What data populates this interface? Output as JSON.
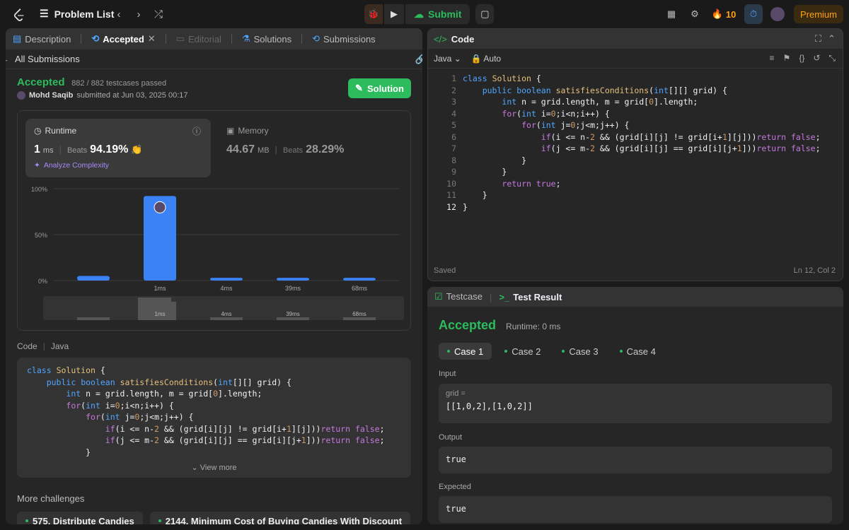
{
  "topbar": {
    "problem_list": "Problem List",
    "submit": "Submit",
    "streak": "10",
    "premium": "Premium"
  },
  "left": {
    "tabs": [
      {
        "label": "Description"
      },
      {
        "label": "Accepted"
      },
      {
        "label": "Editorial"
      },
      {
        "label": "Solutions"
      },
      {
        "label": "Submissions"
      }
    ],
    "all_submissions": "All Submissions",
    "status": "Accepted",
    "testcases": "882 / 882 testcases passed",
    "user": "Mohd Saqib",
    "submitted": "submitted at Jun 03, 2025 00:17",
    "solution_btn": "Solution",
    "runtime": {
      "title": "Runtime",
      "value": "1",
      "unit": "ms",
      "beats_label": "Beats",
      "beats": "94.19%",
      "analyze": "Analyze Complexity"
    },
    "memory": {
      "title": "Memory",
      "value": "44.67",
      "unit": "MB",
      "beats_label": "Beats",
      "beats": "28.29%"
    },
    "chart_ticks": [
      "100%",
      "50%",
      "0%"
    ],
    "chart_bars": [
      "",
      "1ms",
      "4ms",
      "39ms",
      "68ms"
    ],
    "mini_labels": [
      "1ms",
      "4ms",
      "39ms",
      "68ms"
    ],
    "code_label": "Code",
    "lang": "Java",
    "view_more": "View more",
    "more_challenges": "More challenges",
    "challenges": [
      "575. Distribute Candies",
      "2144. Minimum Cost of Buying Candies With Discount"
    ]
  },
  "chart_data": {
    "type": "bar",
    "categories": [
      "",
      "1ms",
      "4ms",
      "39ms",
      "68ms"
    ],
    "values": [
      5,
      92,
      3,
      3,
      3
    ],
    "ylim": [
      0,
      100
    ]
  },
  "editor": {
    "title": "Code",
    "lang": "Java",
    "mode": "Auto",
    "saved": "Saved",
    "pos": "Ln 12, Col 2",
    "lines": [
      "1",
      "2",
      "3",
      "4",
      "5",
      "6",
      "7",
      "8",
      "9",
      "10",
      "11",
      "12"
    ]
  },
  "bottom": {
    "tabs": [
      "Testcase",
      "Test Result"
    ],
    "status": "Accepted",
    "runtime": "Runtime: 0 ms",
    "cases": [
      "Case 1",
      "Case 2",
      "Case 3",
      "Case 4"
    ],
    "input_label": "Input",
    "var": "grid =",
    "input": "[[1,0,2],[1,0,2]]",
    "output_label": "Output",
    "output": "true",
    "expected_label": "Expected",
    "expected": "true"
  }
}
